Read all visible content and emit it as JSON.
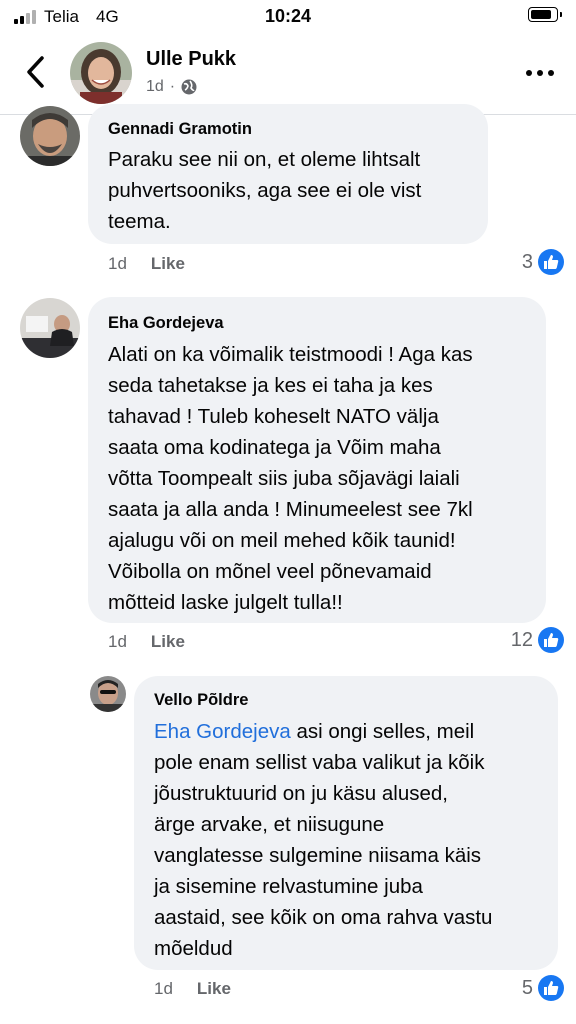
{
  "status_bar": {
    "carrier": "Telia",
    "network": "4G",
    "time": "10:24"
  },
  "header": {
    "name": "Ulle Pukk",
    "age": "1d",
    "separator": "·"
  },
  "comments": [
    {
      "author": "Gennadi Gramotin",
      "text": "Paraku see nii on, et oleme lihtsalt\npuhvertsooniks, aga see ei ole vist\nteema.",
      "time": "1d",
      "like_label": "Like",
      "reactions": "3"
    },
    {
      "author": "Eha Gordejeva",
      "text": "Alati on ka võimalik teistmoodi ! Aga kas\nseda tahetakse ja kes ei taha  ja kes\ntahavad ! Tuleb koheselt NATO välja\nsaata  oma kodinatega  ja Võim maha\nvõtta Toompealt siis juba sõjavägi  laiali\nsaata  ja alla anda ! Minumeelest see 7kl\najalugu   või on meil  mehed kõik  taunid!\nVõibolla on mõnel veel põnevamaid\nmõtteid laske julgelt tulla!!",
      "time": "1d",
      "like_label": "Like",
      "reactions": "12"
    },
    {
      "author": "Vello Põldre",
      "mention": "Eha Gordejeva",
      "text": " asi ongi selles, meil\npole enam sellist vaba valikut ja kõik\njõustruktuurid on ju käsu alused,\närge arvake, et niisugune\nvanglatesse sulgemine niisama käis\nja sisemine relvastumine juba\naastaid, see kõik on oma rahva vastu\nmõeldud",
      "time": "1d",
      "like_label": "Like",
      "reactions": "5"
    }
  ],
  "colors": {
    "bubble": "#f0f2f5",
    "like_blue": "#1877f2",
    "mention": "#216fdb",
    "meta": "#65676b"
  },
  "icons": [
    "signal-icon",
    "battery-icon",
    "back-chevron-icon",
    "globe-icon",
    "more-icon",
    "like-icon"
  ]
}
